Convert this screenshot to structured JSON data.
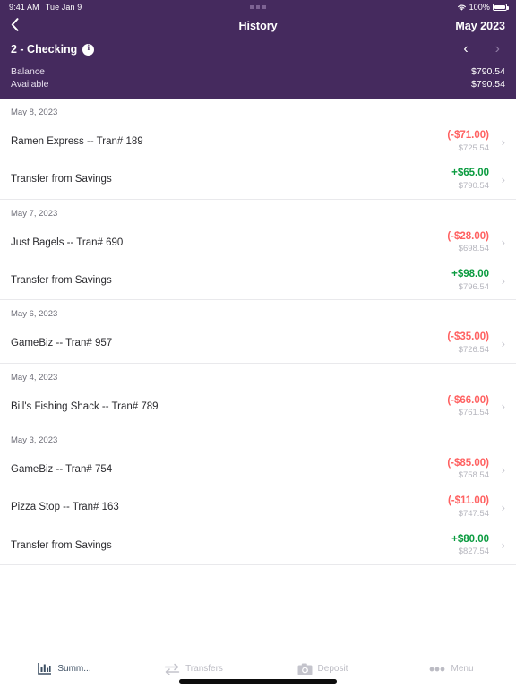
{
  "status_bar": {
    "time": "9:41 AM",
    "date": "Tue Jan 9",
    "battery_percent": "100%",
    "wifi_icon": "wifi-icon",
    "battery_icon": "battery-icon"
  },
  "nav": {
    "back_icon": "chevron-left-icon",
    "title": "History",
    "month": "May 2023"
  },
  "account": {
    "name": "2 - Checking",
    "info_icon": "info-icon",
    "info_glyph": "i",
    "prev_icon": "chevron-left-icon",
    "next_icon": "chevron-right-icon",
    "prev_glyph": "‹",
    "next_glyph": "›",
    "balance_label": "Balance",
    "balance_value": "$790.54",
    "available_label": "Available",
    "available_value": "$790.54"
  },
  "groups": [
    {
      "date": "May 8, 2023",
      "transactions": [
        {
          "description": "Ramen Express -- Tran# 189",
          "amount": "(-$71.00)",
          "sign": "neg",
          "balance": "$725.54"
        },
        {
          "description": "Transfer from Savings",
          "amount": "+$65.00",
          "sign": "pos",
          "balance": "$790.54"
        }
      ]
    },
    {
      "date": "May 7, 2023",
      "transactions": [
        {
          "description": "Just Bagels -- Tran# 690",
          "amount": "(-$28.00)",
          "sign": "neg",
          "balance": "$698.54"
        },
        {
          "description": "Transfer from Savings",
          "amount": "+$98.00",
          "sign": "pos",
          "balance": "$796.54"
        }
      ]
    },
    {
      "date": "May 6, 2023",
      "transactions": [
        {
          "description": "GameBiz -- Tran# 957",
          "amount": "(-$35.00)",
          "sign": "neg",
          "balance": "$726.54"
        }
      ]
    },
    {
      "date": "May 4, 2023",
      "transactions": [
        {
          "description": "Bill's Fishing Shack -- Tran# 789",
          "amount": "(-$66.00)",
          "sign": "neg",
          "balance": "$761.54"
        }
      ]
    },
    {
      "date": "May 3, 2023",
      "transactions": [
        {
          "description": "GameBiz -- Tran# 754",
          "amount": "(-$85.00)",
          "sign": "neg",
          "balance": "$758.54"
        },
        {
          "description": "Pizza Stop -- Tran# 163",
          "amount": "(-$11.00)",
          "sign": "neg",
          "balance": "$747.54"
        },
        {
          "description": "Transfer from Savings",
          "amount": "+$80.00",
          "sign": "pos",
          "balance": "$827.54"
        }
      ]
    }
  ],
  "row_chevron": "›",
  "tabs": [
    {
      "label": "Summ...",
      "icon": "bar-chart-icon",
      "active": true
    },
    {
      "label": "Transfers",
      "icon": "transfer-arrows-icon",
      "active": false
    },
    {
      "label": "Deposit",
      "icon": "camera-icon",
      "active": false
    },
    {
      "label": "Menu",
      "icon": "ellipsis-icon",
      "active": false
    }
  ],
  "colors": {
    "brand_purple": "#452a5e",
    "negative_red": "#ff6161",
    "positive_green": "#0a9b3f",
    "muted_gray": "#b6b6be"
  }
}
